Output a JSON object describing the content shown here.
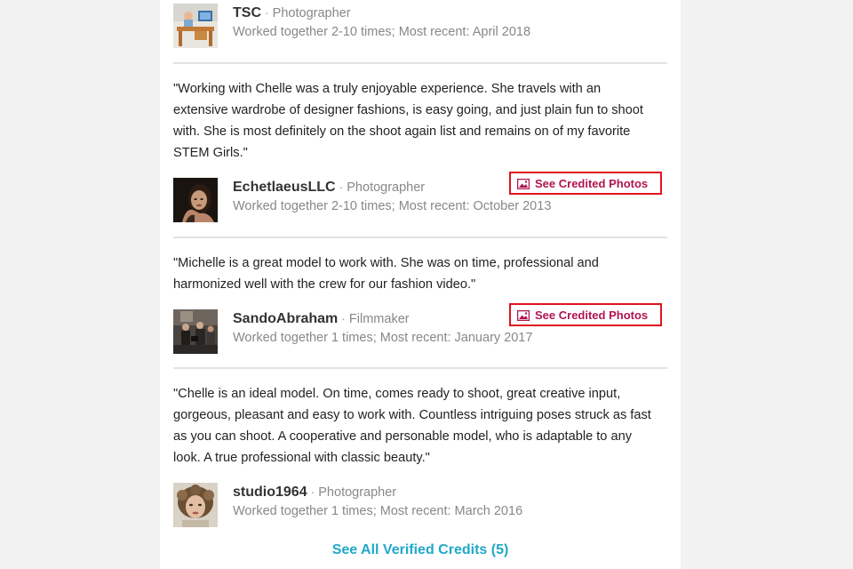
{
  "reviews": [
    {
      "quote": "",
      "name": "TSC",
      "role": "Photographer",
      "meta": "Worked together 2-10 times; Most recent: April 2018",
      "avatar_icon": "desk-photo-avatar",
      "credited_label": ""
    },
    {
      "quote": "\"Working with Chelle was a truly enjoyable experience. She travels with an extensive wardrobe of designer fashions, is easy going, and just plain fun to shoot with. She is most definitely on the shoot again list and remains on of my favorite STEM Girls.\"",
      "name": "EchetlaeusLLC",
      "role": "Photographer",
      "meta": "Worked together 2-10 times; Most recent: October 2013",
      "avatar_icon": "portrait-avatar",
      "credited_label": "See Credited Photos"
    },
    {
      "quote": "\"Michelle is a great model to work with. She was on time, professional and harmonized well with the crew for our fashion video.\"",
      "name": "SandoAbraham",
      "role": "Filmmaker",
      "meta": "Worked together 1 times; Most recent: January 2017",
      "avatar_icon": "film-crew-avatar",
      "credited_label": "See Credited Photos"
    },
    {
      "quote": "\"Chelle is an ideal model. On time, comes ready to shoot, great creative input, gorgeous, pleasant and easy to work with. Countless intriguing poses struck as fast as you can shoot. A cooperative and personable model, who is adaptable to any look. A true professional with classic beauty.\"",
      "name": "studio1964",
      "role": "Photographer",
      "meta": "Worked together 1 times; Most recent: March 2016",
      "avatar_icon": "vintage-portrait-avatar",
      "credited_label": ""
    }
  ],
  "separator": "·",
  "see_all_label": "See All Verified Credits (5)",
  "colors": {
    "credited_border": "#e0141e",
    "credited_text": "#b01550",
    "link": "#21a8c9",
    "divider": "#e3e3e3"
  }
}
